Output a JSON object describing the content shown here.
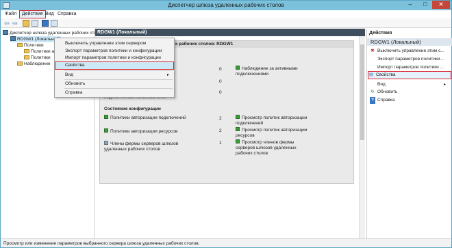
{
  "window": {
    "title": "Диспетчер шлюза удаленных рабочих столов",
    "minimize": "–",
    "maximize": "□",
    "close": "✕"
  },
  "menubar": {
    "items": [
      "Файл",
      "Действие",
      "Вид",
      "Справка"
    ]
  },
  "toolbar": {
    "back": "⇦",
    "forward": "⇨"
  },
  "tree": {
    "root": "Диспетчер шлюза удаленных рабочих столов",
    "server": "RDGW1 (Локальный)",
    "policies": "Политики",
    "policy_a": "Политики а",
    "policy_b": "Политики",
    "monitoring": "Наблюдение"
  },
  "center": {
    "header": "RDGW1 (Локальный)",
    "panel_title": "к рабочих столов: RDGW1",
    "status": {
      "rows": [
        {
          "value": "0",
          "link": "Наблюдение за активными подключениями"
        },
        {
          "value": "0",
          "link": ""
        },
        {
          "label": "подключенных пользователей",
          "value": "0",
          "link": ""
        }
      ]
    },
    "config": {
      "title": "Состояние конфигурации",
      "rows": [
        {
          "label": "Политики авторизации подключений",
          "value": "2",
          "link": "Просмотр политик авторизации подключений"
        },
        {
          "label": "Политики авторизации ресурсов",
          "value": "2",
          "link": "Просмотр политик авторизации ресурсов"
        },
        {
          "label": "Члены фермы серверов шлюзов удаленных рабочих столов",
          "value": "1",
          "link": "Просмотр членов фермы серверов шлюзов удаленных рабочих столов"
        }
      ]
    }
  },
  "context_menu": {
    "items": [
      "Выключить управление этим сервером",
      "Экспорт параметров политики и конфигурации",
      "Импорт параметров политики и конфигурации",
      "Свойства",
      "Вид",
      "Обновить",
      "Справка"
    ]
  },
  "actions": {
    "title": "Действия",
    "section": "RDGW1 (Локальный)",
    "items": [
      {
        "icon": "✖",
        "label": "Выключить управление этим с..."
      },
      {
        "icon": "",
        "label": "Экспорт параметров политики..."
      },
      {
        "icon": "",
        "label": "Импорт параметров политики ..."
      },
      {
        "icon": "▤",
        "label": "Свойства"
      },
      {
        "icon": "",
        "label": "Вид"
      },
      {
        "icon": "↻",
        "label": "Обновить"
      },
      {
        "icon": "?",
        "label": "Справка"
      }
    ]
  },
  "statusbar": {
    "text": "Просмотр или изменение параметров выбранного сервера шлюза удаленных рабочих столов."
  }
}
